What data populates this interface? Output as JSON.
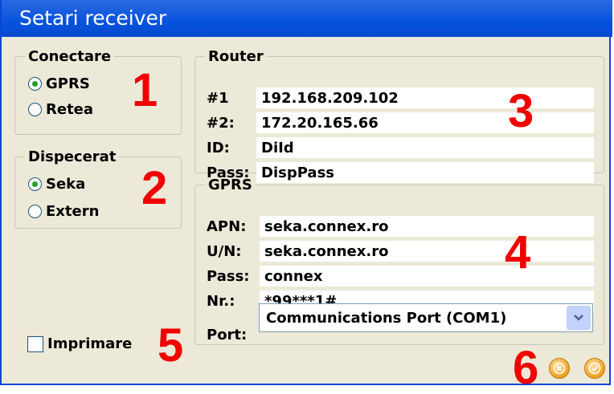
{
  "window": {
    "title": "Setari receiver"
  },
  "conectare": {
    "legend": "Conectare",
    "options": [
      {
        "label": "GPRS",
        "checked": true
      },
      {
        "label": "Retea",
        "checked": false
      }
    ]
  },
  "dispecerat": {
    "legend": "Dispecerat",
    "options": [
      {
        "label": "Seka",
        "checked": true
      },
      {
        "label": "Extern",
        "checked": false
      }
    ]
  },
  "router": {
    "legend": "Router",
    "rows": [
      {
        "label": "#1",
        "value": "192.168.209.102"
      },
      {
        "label": "#2:",
        "value": "172.20.165.66"
      },
      {
        "label": "ID:",
        "value": "DiId"
      },
      {
        "label": "Pass:",
        "value": "DispPass"
      }
    ]
  },
  "gprs": {
    "legend": "GPRS",
    "rows": [
      {
        "label": "APN:",
        "value": "seka.connex.ro"
      },
      {
        "label": "U/N:",
        "value": "seka.connex.ro"
      },
      {
        "label": "Pass:",
        "value": "connex"
      },
      {
        "label": "Nr.:",
        "value": "*99***1#"
      }
    ],
    "port_label": "Port:",
    "port_value": "Communications Port (COM1)"
  },
  "imprimare": {
    "label": "Imprimare",
    "checked": false
  },
  "annotations": [
    "1",
    "2",
    "3",
    "4",
    "5",
    "6"
  ],
  "icons": {
    "cancel": "cancel-circle-icon",
    "ok": "check-circle-icon"
  },
  "colors": {
    "title_bar": "#0553dd",
    "annotation": "#f00000",
    "accent_orange": "#f0a020",
    "radio_dot": "#21a121"
  }
}
